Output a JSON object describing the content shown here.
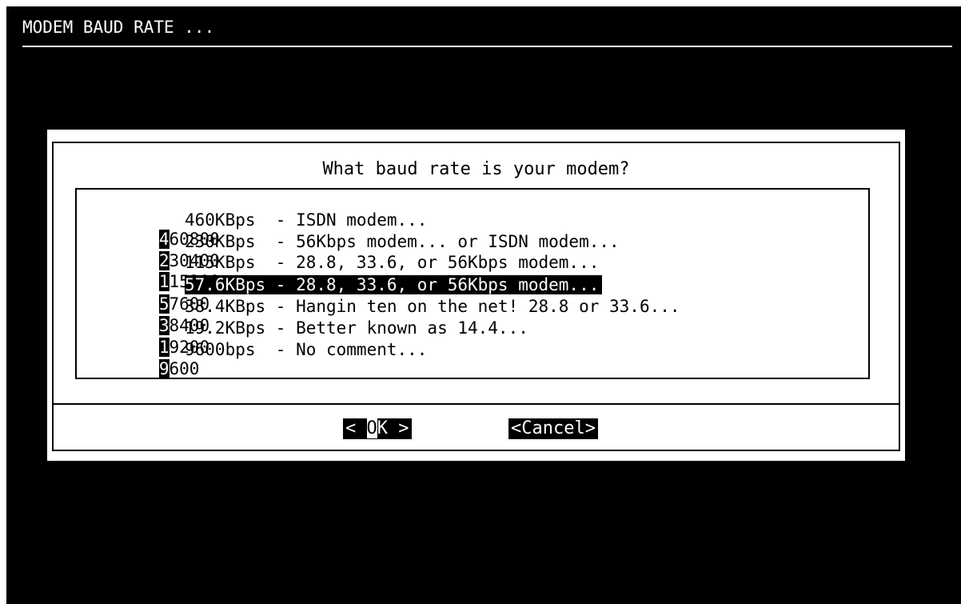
{
  "backtitle": "MODEM BAUD RATE ...",
  "dialog": {
    "prompt": "What baud rate is your modem?",
    "items": [
      {
        "tag_first": "4",
        "tag_rest": "60800",
        "item": "460KBps  - ISDN modem..."
      },
      {
        "tag_first": "2",
        "tag_rest": "30400",
        "item": "230KBps  - 56Kbps modem... or ISDN modem..."
      },
      {
        "tag_first": "1",
        "tag_rest": "15200",
        "item": "115KBps  - 28.8, 33.6, or 56Kbps modem..."
      },
      {
        "tag_first": "5",
        "tag_rest": "7600",
        "item": "57.6KBps - 28.8, 33.6, or 56Kbps modem..."
      },
      {
        "tag_first": "3",
        "tag_rest": "8400",
        "item": "38.4KBps - Hangin ten on the net! 28.8 or 33.6..."
      },
      {
        "tag_first": "1",
        "tag_rest": "9200",
        "item": "19.2KBps - Better known as 14.4..."
      },
      {
        "tag_first": "9",
        "tag_rest": "600",
        "item": "9600bps  - No comment..."
      }
    ],
    "selected_index": 3,
    "buttons": {
      "ok": {
        "left": "< ",
        "hot": "O",
        "rest": "K >"
      },
      "cancel": {
        "left": "<",
        "hot": "C",
        "rest": "ancel>"
      }
    }
  }
}
